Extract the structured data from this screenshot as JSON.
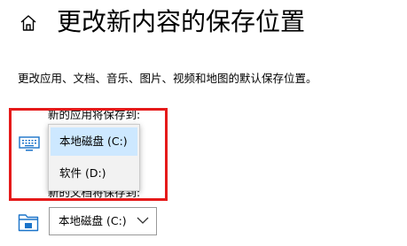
{
  "header": {
    "title": "更改新内容的保存位置",
    "home_icon": "home-icon"
  },
  "description": "更改应用、文档、音乐、图片、视频和地图的默认保存位置。",
  "sections": {
    "apps": {
      "label": "新的应用将保存到:",
      "icon": "monitor-icon"
    },
    "documents": {
      "label": "新的文档将保存到:",
      "icon": "folder-icon",
      "selected": "本地磁盘 (C:)"
    }
  },
  "dropdown": {
    "options": [
      "本地磁盘 (C:)",
      "软件 (D:)"
    ],
    "selected_index": 0
  },
  "colors": {
    "highlight_border": "#e51a1a",
    "selected_item_bg": "#cde8ff",
    "icon_blue": "#1a73c9"
  }
}
